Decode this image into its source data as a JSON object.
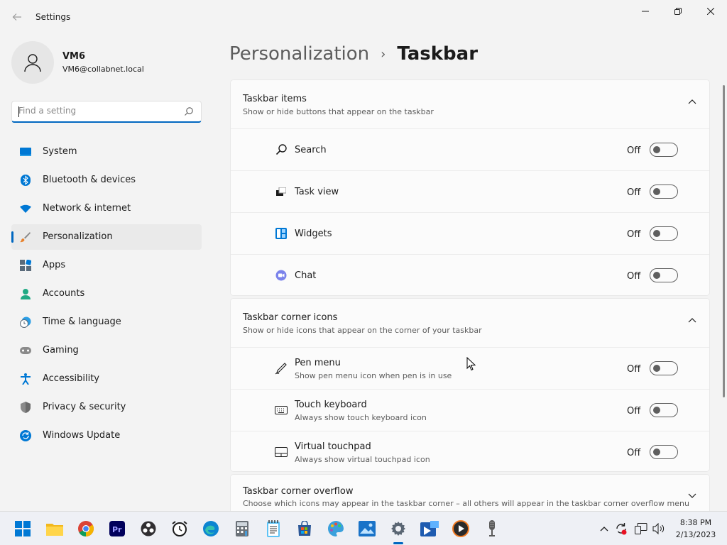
{
  "window": {
    "title": "Settings"
  },
  "profile": {
    "name": "VM6",
    "email": "VM6@collabnet.local"
  },
  "search": {
    "placeholder": "Find a setting",
    "value": ""
  },
  "sidebar": {
    "items": [
      {
        "label": "System",
        "icon": "system-icon",
        "color": "#0078d4"
      },
      {
        "label": "Bluetooth & devices",
        "icon": "bluetooth-icon",
        "color": "#0078d4"
      },
      {
        "label": "Network & internet",
        "icon": "wifi-icon",
        "color": "#0078d4"
      },
      {
        "label": "Personalization",
        "icon": "paintbrush-icon",
        "color": "#e8812b",
        "active": true
      },
      {
        "label": "Apps",
        "icon": "apps-icon",
        "color": "#5a6a7a"
      },
      {
        "label": "Accounts",
        "icon": "accounts-icon",
        "color": "#1faa84"
      },
      {
        "label": "Time & language",
        "icon": "clock-globe-icon",
        "color": "#0078d4"
      },
      {
        "label": "Gaming",
        "icon": "gamepad-icon",
        "color": "#7a7a7a"
      },
      {
        "label": "Accessibility",
        "icon": "accessibility-icon",
        "color": "#0078d4"
      },
      {
        "label": "Privacy & security",
        "icon": "shield-icon",
        "color": "#7a7a7a"
      },
      {
        "label": "Windows Update",
        "icon": "update-icon",
        "color": "#0078d4"
      }
    ]
  },
  "header": {
    "parent": "Personalization",
    "separator": "›",
    "current": "Taskbar"
  },
  "sections": [
    {
      "title": "Taskbar items",
      "description": "Show or hide buttons that appear on the taskbar",
      "expanded": true,
      "rows": [
        {
          "label": "Search",
          "state": "Off",
          "icon": "search-icon"
        },
        {
          "label": "Task view",
          "state": "Off",
          "icon": "task-view-icon"
        },
        {
          "label": "Widgets",
          "state": "Off",
          "icon": "widgets-icon"
        },
        {
          "label": "Chat",
          "state": "Off",
          "icon": "chat-icon"
        }
      ]
    },
    {
      "title": "Taskbar corner icons",
      "description": "Show or hide icons that appear on the corner of your taskbar",
      "expanded": true,
      "rows": [
        {
          "label": "Pen menu",
          "sub": "Show pen menu icon when pen is in use",
          "state": "Off",
          "icon": "pen-icon"
        },
        {
          "label": "Touch keyboard",
          "sub": "Always show touch keyboard icon",
          "state": "Off",
          "icon": "keyboard-icon"
        },
        {
          "label": "Virtual touchpad",
          "sub": "Always show virtual touchpad icon",
          "state": "Off",
          "icon": "touchpad-icon"
        }
      ]
    },
    {
      "title": "Taskbar corner overflow",
      "description": "Choose which icons may appear in the taskbar corner – all others will appear in the taskbar corner overflow menu",
      "expanded": false
    }
  ],
  "taskbar": {
    "apps": [
      "start-icon",
      "file-explorer-icon",
      "chrome-icon",
      "premiere-icon",
      "obs-icon",
      "alarm-clock-icon",
      "edge-icon",
      "calculator-icon",
      "notepad-icon",
      "store-icon",
      "paint-icon",
      "photos-icon",
      "settings-icon",
      "video-editor-icon",
      "media-player-icon",
      "microphone-icon"
    ],
    "tray": [
      "chevron-up-icon",
      "sync-icon",
      "network-icon",
      "volume-icon"
    ],
    "time": "8:38 PM",
    "date": "2/13/2023"
  }
}
